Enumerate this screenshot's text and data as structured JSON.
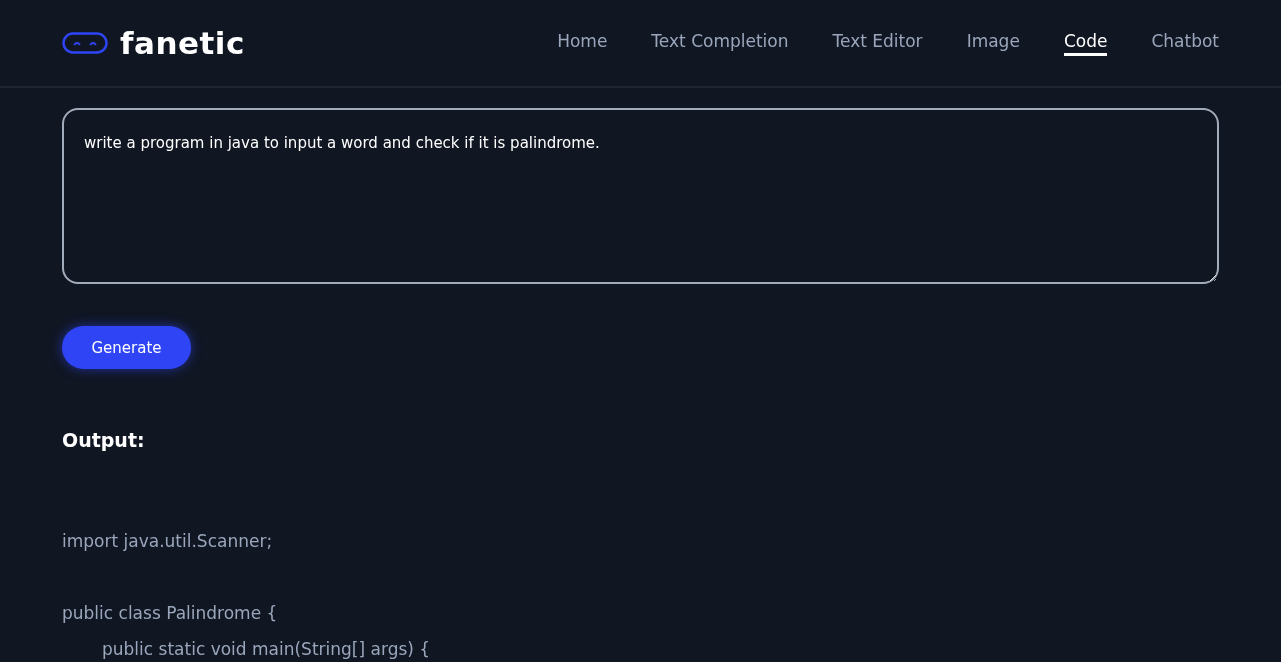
{
  "brand": {
    "name": "fanetic"
  },
  "nav": [
    {
      "label": "Home",
      "selected": false
    },
    {
      "label": "Text Completion",
      "selected": false
    },
    {
      "label": "Text Editor",
      "selected": false
    },
    {
      "label": "Image",
      "selected": false
    },
    {
      "label": "Code",
      "selected": true
    },
    {
      "label": "Chatbot",
      "selected": false
    }
  ],
  "prompt": {
    "value": "write a program in java to input a word and check if it is palindrome."
  },
  "generate_button": "Generate",
  "output": {
    "heading": "Output:",
    "code": [
      {
        "text": "import java.util.Scanner;"
      },
      {
        "text": "public class Palindrome {",
        "children": [
          {
            "text": "public static void main(String[] args) {"
          }
        ]
      }
    ]
  }
}
